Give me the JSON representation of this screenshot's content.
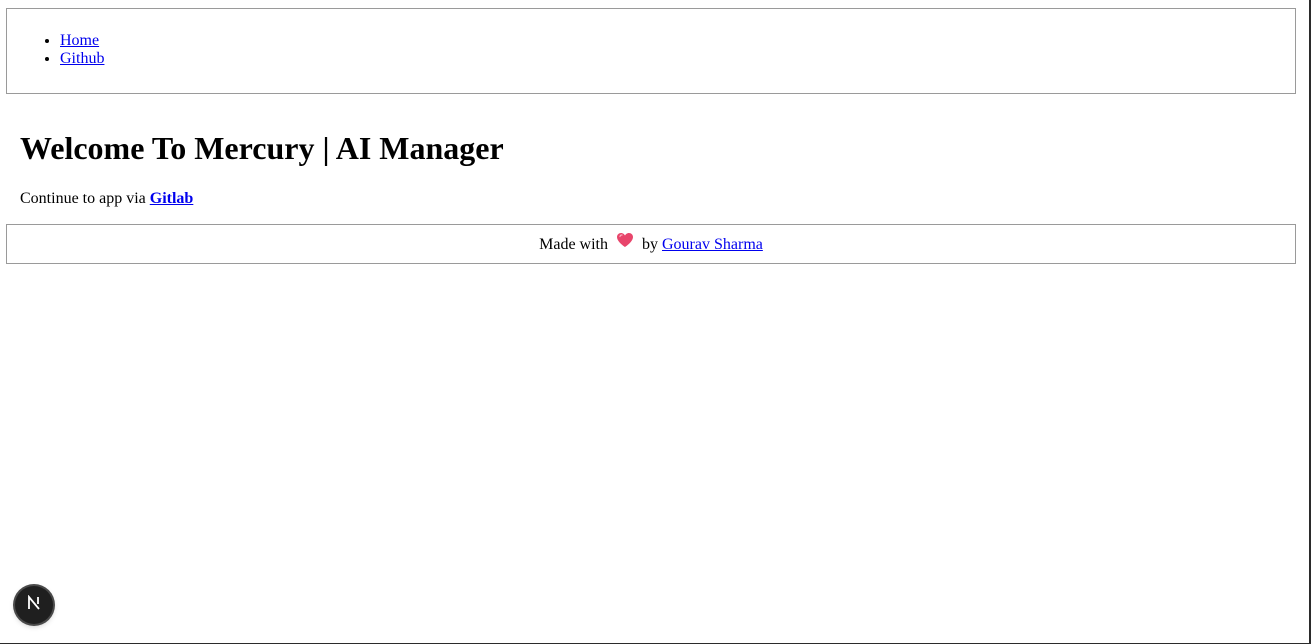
{
  "nav": {
    "items": [
      {
        "label": "Home"
      },
      {
        "label": "Github"
      }
    ]
  },
  "main": {
    "title": "Welcome To Mercury | AI Manager",
    "continue_prefix": "Continue to app via ",
    "continue_link": "Gitlab"
  },
  "footer": {
    "prefix": "Made with",
    "icon": "heart-icon",
    "by": "by",
    "author": "Gourav Sharma"
  },
  "badge": {
    "icon": "nextjs-icon"
  },
  "colors": {
    "link": "#0000ee",
    "heart": "#e8456b",
    "badge_bg": "#1f1f1f"
  }
}
